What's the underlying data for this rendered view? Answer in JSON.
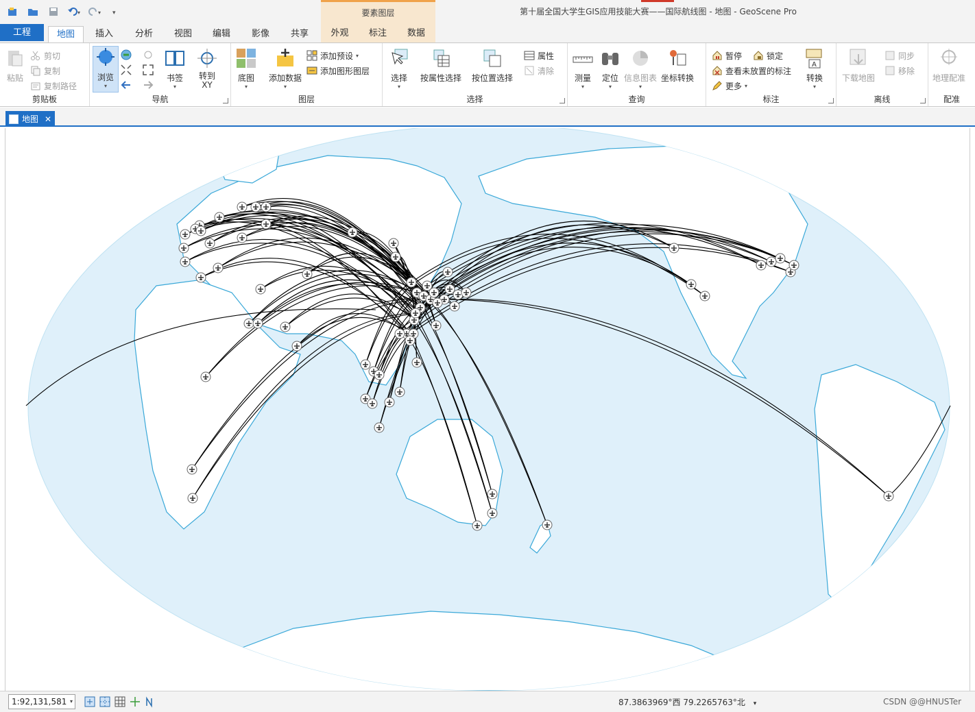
{
  "window": {
    "title": "第十届全国大学生GIS应用技能大赛——国际航线图 - 地图 - GeoScene Pro",
    "context_group": "要素图层"
  },
  "tabs": [
    {
      "label": "工程",
      "kind": "file"
    },
    {
      "label": "地图",
      "kind": "active"
    },
    {
      "label": "插入"
    },
    {
      "label": "分析"
    },
    {
      "label": "视图"
    },
    {
      "label": "编辑"
    },
    {
      "label": "影像"
    },
    {
      "label": "共享"
    },
    {
      "label": "外观",
      "kind": "ctx"
    },
    {
      "label": "标注",
      "kind": "ctx"
    },
    {
      "label": "数据",
      "kind": "ctx"
    }
  ],
  "ribbon": {
    "clipboard": {
      "label": "剪贴板",
      "paste": "粘贴",
      "cut": "剪切",
      "copy": "复制",
      "copy_path": "复制路径"
    },
    "navigate": {
      "label": "导航",
      "explore": "浏览",
      "bookmarks": "书签",
      "goto_xy": "转到\nXY"
    },
    "layer": {
      "label": "图层",
      "basemap": "底图",
      "add_data": "添加数据",
      "add_preset": "添加预设",
      "add_graphics": "添加图形图层"
    },
    "selection": {
      "label": "选择",
      "select": "选择",
      "by_attr": "按属性选择",
      "by_loc": "按位置选择",
      "attributes": "属性",
      "clear": "清除"
    },
    "inquiry": {
      "label": "查询",
      "measure": "测量",
      "locate": "定位",
      "infographics": "信息图表",
      "convert_coords": "坐标转换"
    },
    "labeling": {
      "label": "标注",
      "pause": "暂停",
      "lock": "锁定",
      "unplaced": "查看未放置的标注",
      "more": "更多",
      "convert": "转换"
    },
    "offline": {
      "label": "离线",
      "download": "下载地图",
      "sync": "同步",
      "remove": "移除"
    },
    "georef": {
      "label": "配准",
      "georeference": "地理配准"
    }
  },
  "view_tab": {
    "label": "地图",
    "close": "✕"
  },
  "statusbar": {
    "scale": "1:92,131,581",
    "coords": "87.3863969°西 79.2265763°北",
    "watermark": "CSDN @@HNUSTer"
  },
  "colors": {
    "accent": "#1f6fc6",
    "ocean": "#dff0fa",
    "coast": "#3aa8d8",
    "land": "#ffffff",
    "route": "#000000",
    "context": "#f8e7cf"
  },
  "map": {
    "hub": "China (Beijing/Shanghai/Guangzhou)",
    "routes_to": [
      "Europe",
      "Middle East",
      "Africa",
      "South Asia",
      "Southeast Asia",
      "Australia",
      "New Zealand",
      "North America",
      "South America"
    ]
  }
}
